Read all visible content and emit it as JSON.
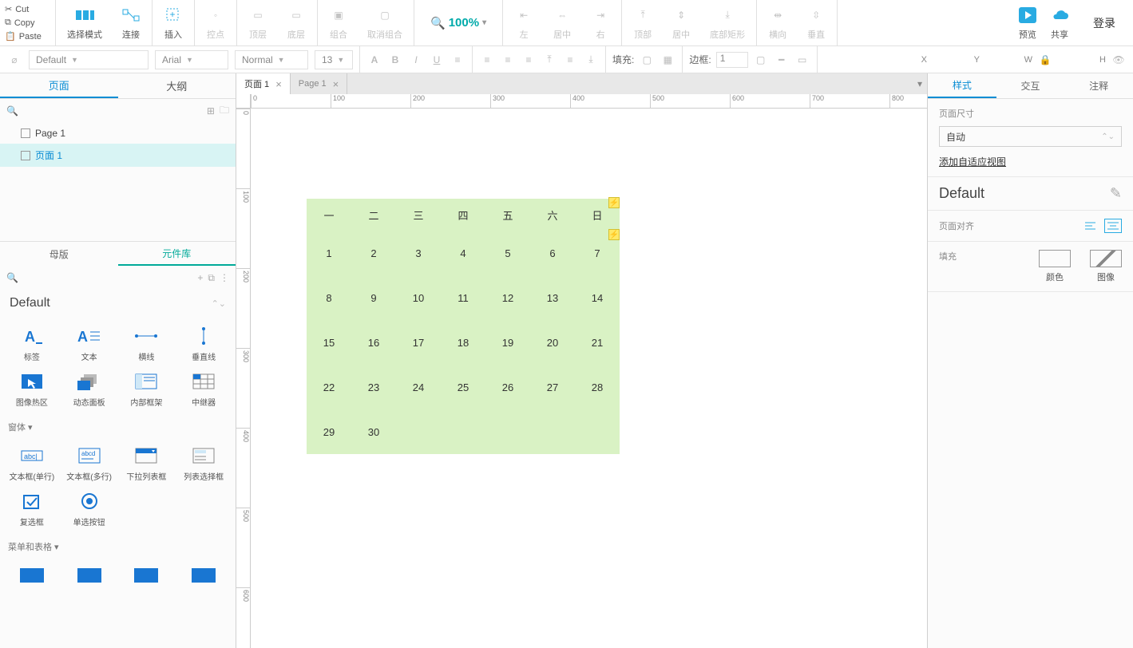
{
  "edit": {
    "cut": "Cut",
    "copy": "Copy",
    "paste": "Paste"
  },
  "toolbar": {
    "select_mode": "选择模式",
    "connect": "连接",
    "insert": "插入",
    "points": "控点",
    "front": "顶层",
    "back": "底层",
    "group": "组合",
    "ungroup": "取消组合",
    "zoom": "100%",
    "left": "左",
    "center_h": "居中",
    "right_a": "右",
    "top": "顶部",
    "middle": "居中",
    "bottom": "底部矩形",
    "dist_h": "横向",
    "dist_v": "垂直",
    "preview": "预览",
    "share": "共享",
    "login": "登录"
  },
  "fmt": {
    "style": "Default",
    "font": "Arial",
    "weight": "Normal",
    "size": "13",
    "fill_label": "填充:",
    "border_label": "边框:",
    "border_val": "1",
    "x": "X",
    "y": "Y",
    "w": "W",
    "h": "H"
  },
  "left": {
    "tab_pages": "页面",
    "tab_outline": "大纲",
    "pages": [
      {
        "name": "Page 1",
        "active": false
      },
      {
        "name": "页面 1",
        "active": true
      }
    ],
    "tab_masters": "母版",
    "tab_widgets": "元件库",
    "lib_name": "Default",
    "sect_form": "窗体 ▾",
    "sect_menu": "菜单和表格 ▾",
    "w": {
      "label": "标签",
      "text": "文本",
      "hline": "横线",
      "vline": "垂直线",
      "hotspot": "图像热区",
      "dpanel": "动态面板",
      "iframe": "内部框架",
      "repeater": "中继器",
      "tfield": "文本框(单行)",
      "tarea": "文本框(多行)",
      "droplist": "下拉列表框",
      "listbox": "列表选择框",
      "checkbox": "复选框",
      "radio": "单选按钮"
    }
  },
  "canvas": {
    "tab1": "页面 1",
    "tab2": "Page 1",
    "hticks": [
      "0",
      "100",
      "200",
      "300",
      "400",
      "500",
      "600",
      "700",
      "800"
    ],
    "vticks": [
      "0",
      "100",
      "200",
      "300",
      "400",
      "500",
      "600"
    ],
    "calendar": {
      "head": [
        "一",
        "二",
        "三",
        "四",
        "五",
        "六",
        "日"
      ],
      "rows": [
        [
          "1",
          "2",
          "3",
          "4",
          "5",
          "6",
          "7"
        ],
        [
          "8",
          "9",
          "10",
          "11",
          "12",
          "13",
          "14"
        ],
        [
          "15",
          "16",
          "17",
          "18",
          "19",
          "20",
          "21"
        ],
        [
          "22",
          "23",
          "24",
          "25",
          "26",
          "27",
          "28"
        ],
        [
          "29",
          "30",
          "",
          "",
          "",
          "",
          ""
        ]
      ]
    }
  },
  "right": {
    "tab_style": "样式",
    "tab_interact": "交互",
    "tab_notes": "注释",
    "page_size": "页面尺寸",
    "auto": "自动",
    "add_view": "添加自适应视图",
    "default": "Default",
    "page_align": "页面对齐",
    "fill": "填充",
    "color": "颜色",
    "image": "图像"
  }
}
